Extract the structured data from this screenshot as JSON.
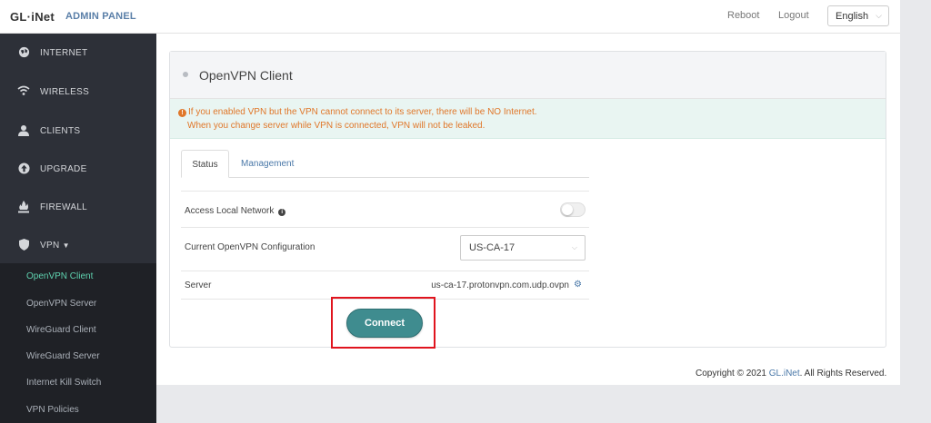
{
  "header": {
    "logo": "GL·iNet",
    "admin": "ADMIN PANEL",
    "reboot": "Reboot",
    "logout": "Logout",
    "language": "English"
  },
  "sidebar": {
    "items": [
      {
        "label": "INTERNET",
        "icon": "globe-icon"
      },
      {
        "label": "WIRELESS",
        "icon": "wifi-icon"
      },
      {
        "label": "CLIENTS",
        "icon": "user-icon"
      },
      {
        "label": "UPGRADE",
        "icon": "upgrade-icon"
      },
      {
        "label": "FIREWALL",
        "icon": "fire-icon"
      },
      {
        "label": "VPN",
        "icon": "shield-icon"
      }
    ],
    "vpn_sub": [
      "OpenVPN Client",
      "OpenVPN Server",
      "WireGuard Client",
      "WireGuard Server",
      "Internet Kill Switch",
      "VPN Policies"
    ]
  },
  "card": {
    "title": "OpenVPN Client",
    "warning_line1": "If you enabled VPN but the VPN cannot connect to its server, there will be NO Internet.",
    "warning_line2": "When you change server while VPN is connected, VPN will not be leaked.",
    "tabs": [
      "Status",
      "Management"
    ],
    "rows": {
      "access_local": "Access Local Network",
      "access_local_enabled": false,
      "current_config_label": "Current OpenVPN Configuration",
      "current_config_value": "US-CA-17",
      "server_label": "Server",
      "server_value": "us-ca-17.protonvpn.com.udp.ovpn"
    },
    "connect": "Connect"
  },
  "footer": {
    "prefix": "Copyright © 2021",
    "brand": "GL.iNet",
    "suffix": ". All Rights Reserved."
  }
}
